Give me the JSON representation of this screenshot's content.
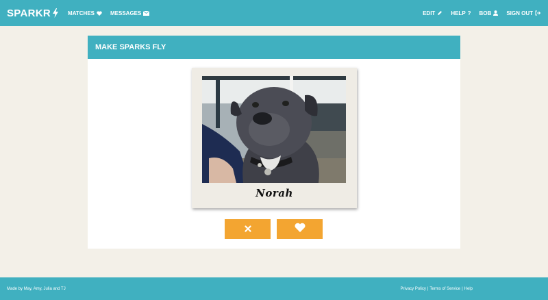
{
  "brand": {
    "name": "SPARKR",
    "icon": "bolt-icon"
  },
  "nav": {
    "left": [
      {
        "label": "MATCHES",
        "icon": "heart-icon"
      },
      {
        "label": "MESSAGES",
        "icon": "envelope-icon"
      }
    ],
    "right": [
      {
        "label": "EDIT",
        "icon": "pencil-icon"
      },
      {
        "label": "HELP",
        "icon": "question-icon"
      },
      {
        "label": "BOB",
        "icon": "user-icon"
      },
      {
        "label": "SIGN OUT",
        "icon": "sign-out-icon"
      }
    ]
  },
  "panel": {
    "title": "MAKE SPARKS FLY"
  },
  "profile": {
    "name": "Norah",
    "photo": "dog-photo"
  },
  "actions": {
    "reject_icon": "close-icon",
    "like_icon": "heart-icon"
  },
  "footer": {
    "credit": "Made by May, Amy, Julia and TJ",
    "links": [
      "Privacy Policy",
      "Terms of Service",
      "Help"
    ],
    "separator": "|"
  },
  "colors": {
    "accent": "#40b0c0",
    "action": "#f3a531",
    "background": "#f3f0e8",
    "polaroid": "#efece5"
  }
}
